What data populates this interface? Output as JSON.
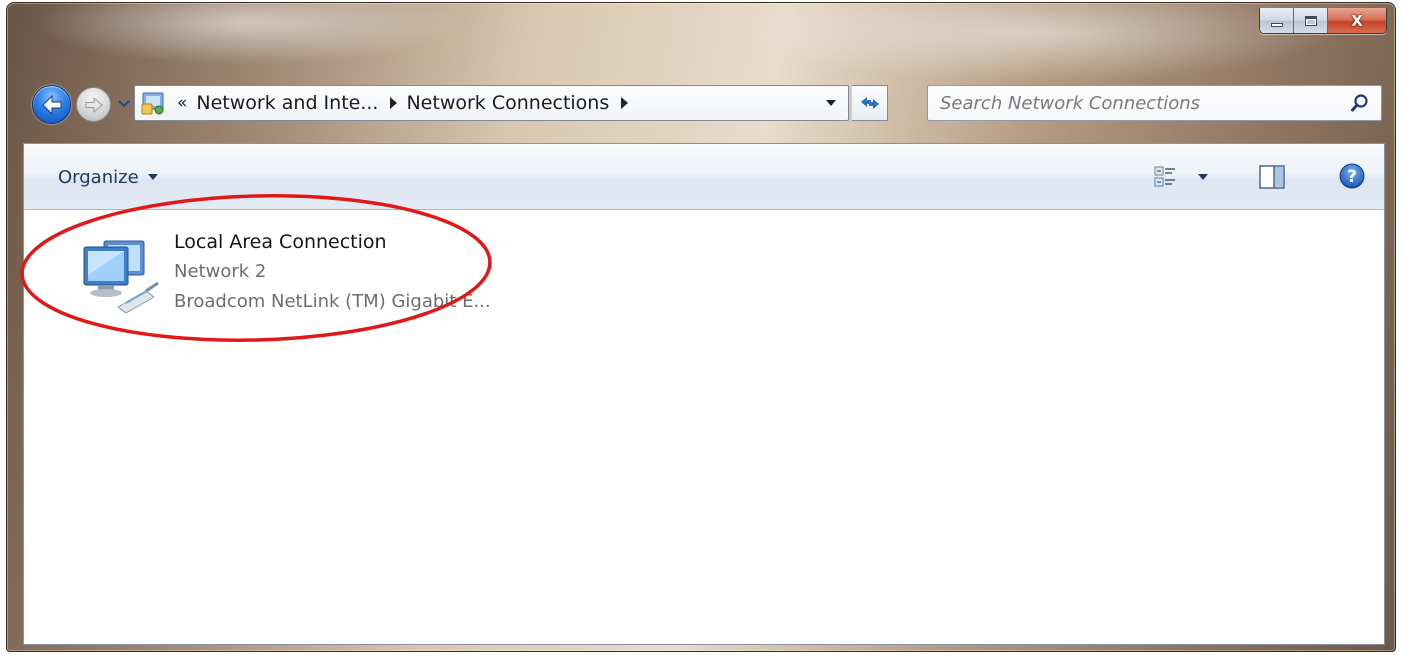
{
  "window": {
    "caption_buttons": {
      "minimize_icon": "minimize-icon",
      "maximize_icon": "maximize-icon",
      "close_glyph": "X"
    }
  },
  "navigation": {
    "back_icon": "back-arrow-icon",
    "forward_icon": "forward-arrow-icon",
    "recent_pages_icon": "chevron-down-icon",
    "address": {
      "location_icon": "network-connections-folder-icon",
      "overflow_chevrons": "«",
      "breadcrumbs": [
        {
          "label": "Network and Inte..."
        },
        {
          "label": "Network Connections"
        }
      ],
      "dropdown_icon": "chevron-down-icon"
    },
    "refresh_icon": "refresh-icon",
    "search": {
      "placeholder": "Search Network Connections",
      "value": "",
      "icon": "search-icon"
    }
  },
  "commandbar": {
    "organize_label": "Organize",
    "change_view_icon": "details-view-icon",
    "preview_pane_icon": "preview-pane-icon",
    "help_icon": "help-icon"
  },
  "connections": [
    {
      "name": "Local Area Connection",
      "network": "Network  2",
      "device": "Broadcom NetLink (TM) Gigabit E...",
      "icon": "network-adapter-icon"
    }
  ],
  "annotation": {
    "type": "ellipse",
    "color": "#e01818"
  },
  "colors": {
    "link_text": "#1e395b",
    "secondary_text": "#6d6d6d",
    "annotation_red": "#e01818"
  }
}
